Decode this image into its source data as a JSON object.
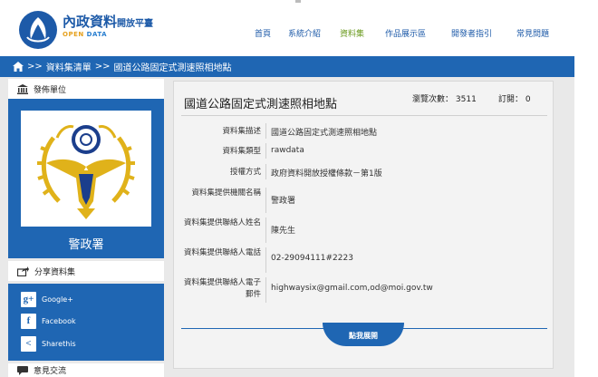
{
  "header": {
    "logo_title": "內政資料",
    "logo_title_small": "開放平臺",
    "logo_sub_open": "OPEN",
    "logo_sub_data": "DATA",
    "nav": [
      "首頁",
      "系統介紹",
      "資料集",
      "作品展示區",
      "開發者指引",
      "常見問題"
    ],
    "active_nav": "資料集"
  },
  "breadcrumb": {
    "sep": ">>",
    "items": [
      "資料集清單",
      "國道公路固定式測速照相地點"
    ]
  },
  "sidebar": {
    "publisher_heading": "發佈單位",
    "publisher_name": "警政署",
    "share_heading": "分享資料集",
    "share_items": [
      {
        "icon": "google-plus-icon",
        "glyph": "g+",
        "label": "Google+"
      },
      {
        "icon": "facebook-icon",
        "glyph": "f",
        "label": "Facebook"
      },
      {
        "icon": "share-icon",
        "glyph": "<",
        "label": "Sharethis"
      }
    ],
    "feedback_heading": "意見交流"
  },
  "dataset": {
    "title": "國道公路固定式測速照相地點",
    "views_label": "瀏覽次數：",
    "views_count": "3511",
    "subs_label": "訂閱：",
    "subs_count": "0",
    "fields": [
      {
        "label": "資料集描述",
        "value": "國道公路固定式測速照相地點"
      },
      {
        "label": "資料集類型",
        "value": "rawdata"
      },
      {
        "label": "授權方式",
        "value": "政府資料開放授權條款－第1版"
      },
      {
        "label": "資料集提供機關名稱",
        "value": "警政署"
      },
      {
        "label": "資料集提供聯絡人姓名",
        "value": "陳先生"
      },
      {
        "label": "資料集提供聯絡人電話",
        "value": "02-29094111#2223"
      },
      {
        "label": "資料集提供聯絡人電子郵件",
        "value": "highwaysix@gmail.com,od@moi.gov.tw"
      }
    ],
    "expand_label": "點我展開"
  },
  "colors": {
    "primary": "#1f66b3",
    "nav_active": "#6a9a1e",
    "emblem_gold": "#e0b21a",
    "emblem_blue": "#1b3e8c"
  }
}
